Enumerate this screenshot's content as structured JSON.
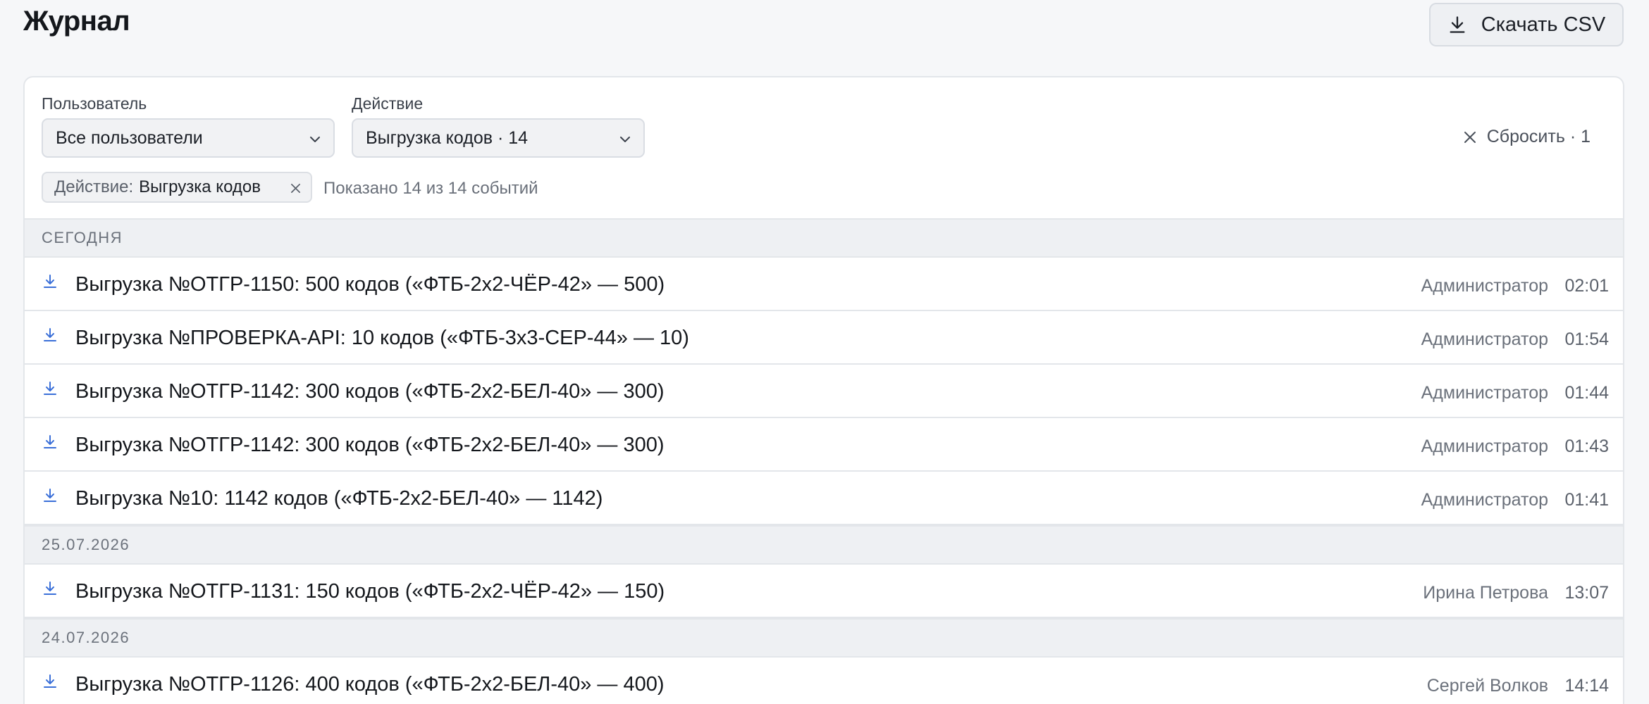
{
  "header": {
    "title": "Журнал",
    "csv_label": "Скачать CSV"
  },
  "filters": {
    "user": {
      "label": "Пользователь",
      "value": "Все пользователи"
    },
    "action": {
      "label": "Действие",
      "value": "Выгрузка кодов · 14"
    },
    "reset_label": "Сбросить · 1",
    "chip": {
      "key": "Действие:",
      "value": "Выгрузка кодов"
    },
    "shown_text": "Показано 14 из 14 событий"
  },
  "groups": [
    {
      "title": "СЕГОДНЯ",
      "rows": [
        {
          "text": "Выгрузка №ОТГР-1150: 500 кодов («ФТБ-2x2-ЧЁР-42» — 500)",
          "user": "Администратор",
          "time": "02:01"
        },
        {
          "text": "Выгрузка №ПРОВЕРКА-API: 10 кодов («ФТБ-3x3-СЕР-44» — 10)",
          "user": "Администратор",
          "time": "01:54"
        },
        {
          "text": "Выгрузка №ОТГР-1142: 300 кодов («ФТБ-2x2-БЕЛ-40» — 300)",
          "user": "Администратор",
          "time": "01:44"
        },
        {
          "text": "Выгрузка №ОТГР-1142: 300 кодов («ФТБ-2x2-БЕЛ-40» — 300)",
          "user": "Администратор",
          "time": "01:43"
        },
        {
          "text": "Выгрузка №10: 1142 кодов («ФТБ-2x2-БЕЛ-40» — 1142)",
          "user": "Администратор",
          "time": "01:41"
        }
      ]
    },
    {
      "title": "25.07.2026",
      "rows": [
        {
          "text": "Выгрузка №ОТГР-1131: 150 кодов («ФТБ-2x2-ЧЁР-42» — 150)",
          "user": "Ирина Петрова",
          "time": "13:07"
        }
      ]
    },
    {
      "title": "24.07.2026",
      "rows": [
        {
          "text": "Выгрузка №ОТГР-1126: 400 кодов («ФТБ-2x2-БЕЛ-40» — 400)",
          "user": "Сергей Волков",
          "time": "14:14"
        }
      ]
    }
  ],
  "icons": {
    "row": "download-icon",
    "csv": "download-icon",
    "select": "chevron-down-icon",
    "reset": "close-icon",
    "chip_remove": "close-icon"
  },
  "colors": {
    "accent_icon": "#3a6fd8",
    "background": "#f6f7f9",
    "group_header": "#eef0f3"
  }
}
